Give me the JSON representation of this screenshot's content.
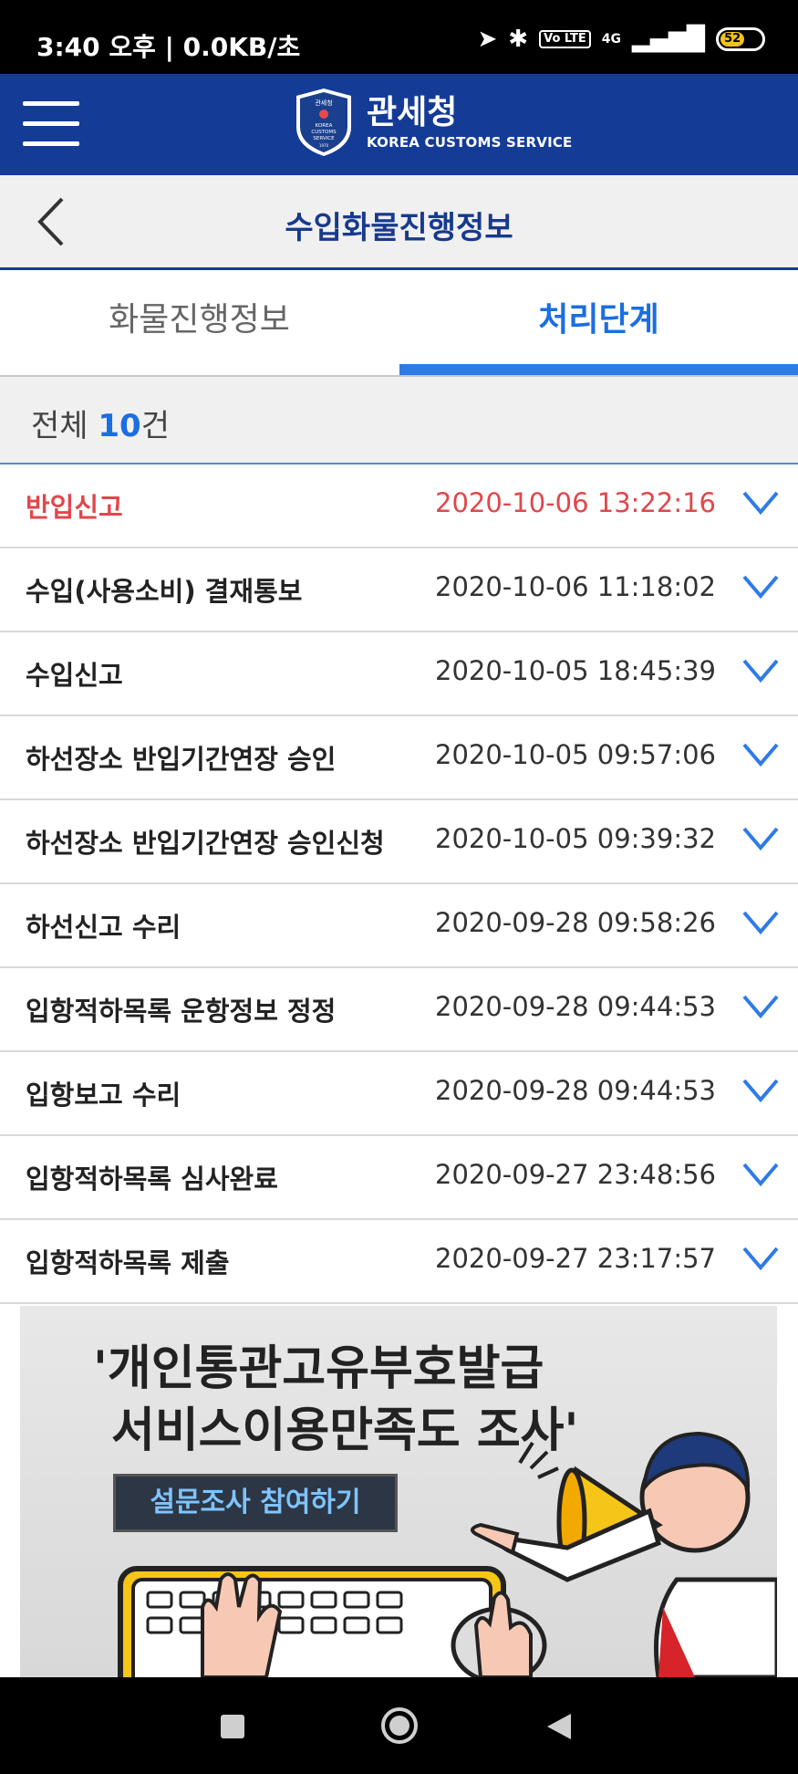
{
  "status_bar": {
    "time_info": "3:40 오후 | 0.0KB/초",
    "network_label": "4G",
    "volte_label": "Vo LTE",
    "battery": "52"
  },
  "header": {
    "brand_ko": "관세청",
    "brand_en": "KOREA CUSTOMS SERVICE",
    "emblem_ko": "관세청",
    "emblem_en_1": "KOREA",
    "emblem_en_2": "CUSTOMS",
    "emblem_en_3": "SERVICE",
    "emblem_year": "1970"
  },
  "titlebar": {
    "title": "수입화물진행정보"
  },
  "tabs": [
    {
      "label": "화물진행정보",
      "active": false
    },
    {
      "label": "처리단계",
      "active": true
    }
  ],
  "summary": {
    "prefix": "전체",
    "count": "10",
    "suffix": "건"
  },
  "rows": [
    {
      "label": "반입신고",
      "time": "2020-10-06 13:22:16",
      "highlight": true
    },
    {
      "label": "수입(사용소비) 결재통보",
      "time": "2020-10-06 11:18:02",
      "highlight": false
    },
    {
      "label": "수입신고",
      "time": "2020-10-05 18:45:39",
      "highlight": false
    },
    {
      "label": "하선장소 반입기간연장 승인",
      "time": "2020-10-05 09:57:06",
      "highlight": false
    },
    {
      "label": "하선장소 반입기간연장 승인신청",
      "time": "2020-10-05 09:39:32",
      "highlight": false
    },
    {
      "label": "하선신고 수리",
      "time": "2020-09-28 09:58:26",
      "highlight": false
    },
    {
      "label": "입항적하목록 운항정보 정정",
      "time": "2020-09-28 09:44:53",
      "highlight": false
    },
    {
      "label": "입항보고 수리",
      "time": "2020-09-28 09:44:53",
      "highlight": false
    },
    {
      "label": "입항적하목록 심사완료",
      "time": "2020-09-27 23:48:56",
      "highlight": false
    },
    {
      "label": "입항적하목록 제출",
      "time": "2020-09-27 23:17:57",
      "highlight": false
    }
  ],
  "banner": {
    "line1": "'개인통관고유부호발급",
    "line2": "서비스이용만족도 조사'",
    "button": "설문조사 참여하기"
  },
  "colors": {
    "header_bg": "#143c96",
    "accent": "#1b6ee0",
    "highlight": "#e0474c"
  }
}
